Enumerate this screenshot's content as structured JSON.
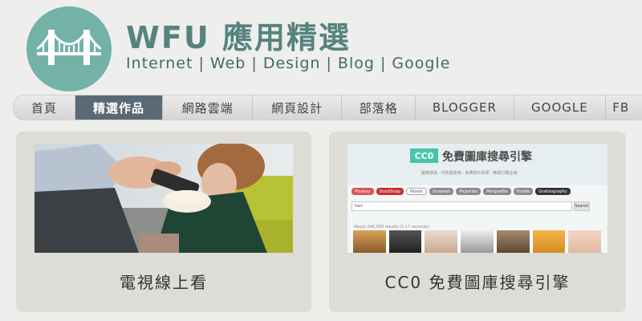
{
  "header": {
    "title": "WFU 應用精選",
    "subtitle": "Internet | Web | Design | Blog | Google"
  },
  "nav": {
    "active_index": 1,
    "items": [
      {
        "label": "首頁"
      },
      {
        "label": "精選作品"
      },
      {
        "label": "網路雲端"
      },
      {
        "label": "網頁設計"
      },
      {
        "label": "部落格"
      },
      {
        "label": "BLOGGER"
      },
      {
        "label": "GOOGLE"
      },
      {
        "label": "FB"
      }
    ]
  },
  "cards": [
    {
      "title": "電視線上看"
    },
    {
      "title": "CC0 免費圖庫搜尋引擎"
    }
  ],
  "cc0_preview": {
    "badge": "CC0",
    "title": "免費圖庫搜尋引擎",
    "tagline": "圖庫搜尋 · 可商業使用 · 免費標示來源 · 無需付費註冊",
    "tabs": [
      "Pixabay",
      "StockSnap",
      "Pexels",
      "Unsplash",
      "Picjumbo",
      "Morguefile",
      "Foodie",
      "Gratisography"
    ],
    "search_value": "hair",
    "search_button": "Search",
    "result_text": "About 246,000 results (0.17 seconds)"
  },
  "colors": {
    "logo_bg": "#74b2a8",
    "title": "#56837e",
    "nav_active": "#596a76",
    "card_bg": "#dedcd6"
  }
}
